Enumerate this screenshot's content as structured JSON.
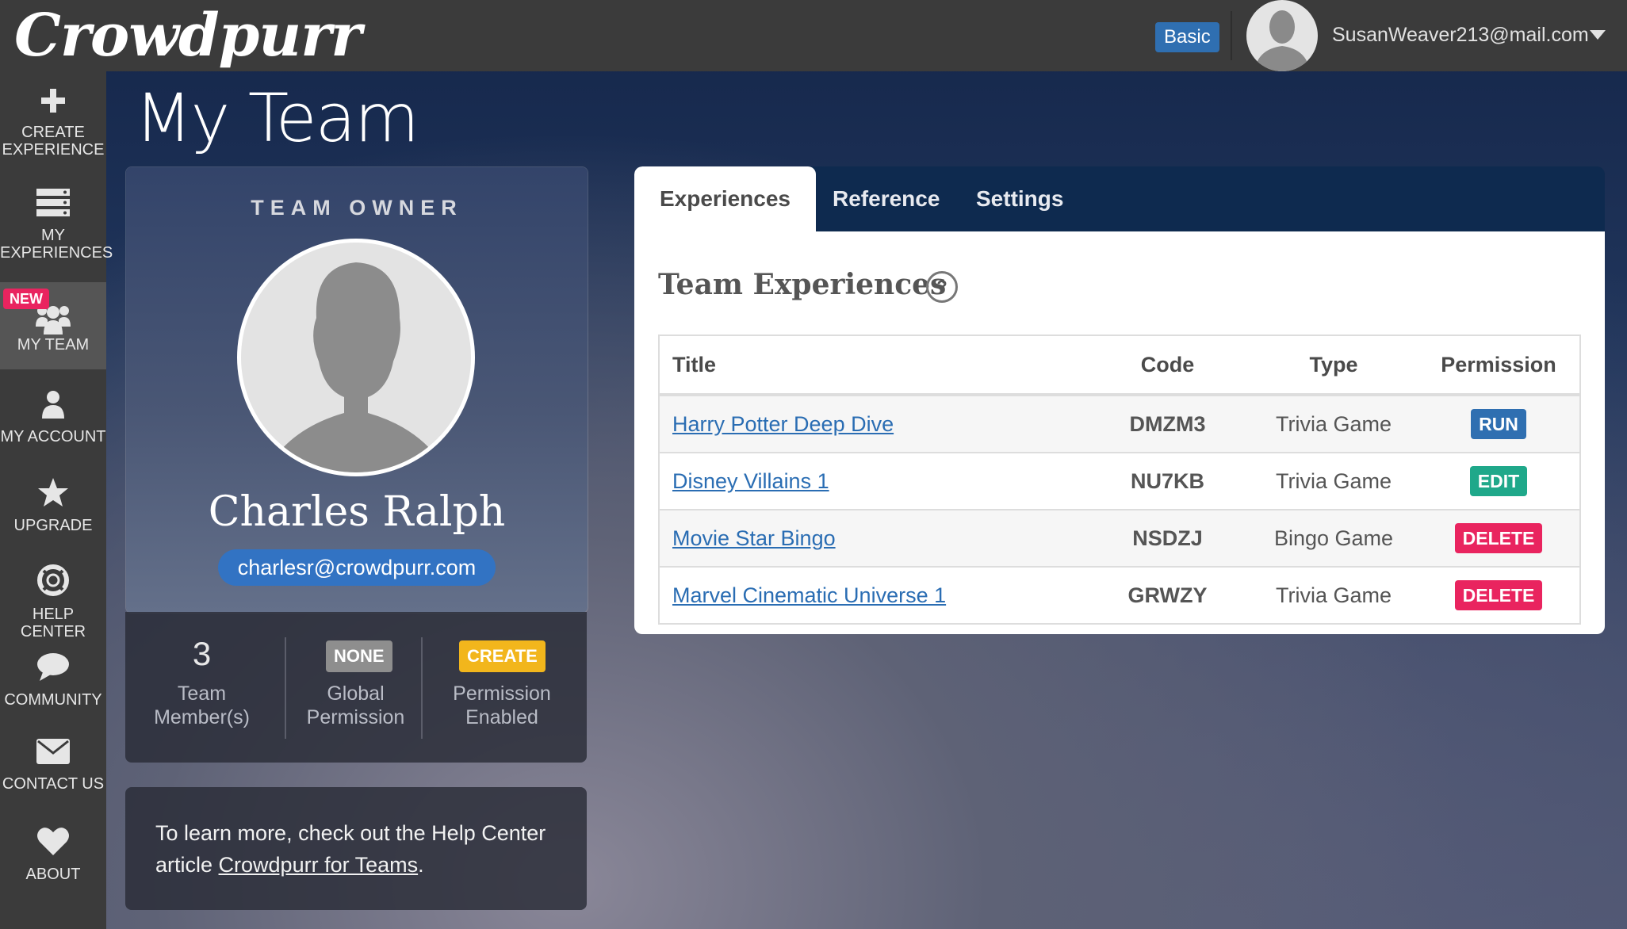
{
  "app": {
    "logo_text": "Crowdpurr",
    "plan_badge": "Basic",
    "user_email": "SusanWeaver213@mail.com"
  },
  "sidebar": {
    "items": [
      {
        "label_line1": "CREATE",
        "label_line2": "EXPERIENCE",
        "icon": "plus-icon"
      },
      {
        "label_line1": "MY",
        "label_line2": "EXPERIENCES",
        "icon": "list-icon"
      },
      {
        "label_line1": "MY TEAM",
        "label_line2": "",
        "icon": "team-icon",
        "badge": "NEW",
        "active": true
      },
      {
        "label_line1": "MY ACCOUNT",
        "label_line2": "",
        "icon": "user-icon"
      },
      {
        "label_line1": "UPGRADE",
        "label_line2": "",
        "icon": "star-icon"
      },
      {
        "label_line1": "HELP CENTER",
        "label_line2": "",
        "icon": "lifebuoy-icon"
      },
      {
        "label_line1": "COMMUNITY",
        "label_line2": "",
        "icon": "chat-icon"
      },
      {
        "label_line1": "CONTACT US",
        "label_line2": "",
        "icon": "envelope-icon"
      },
      {
        "label_line1": "ABOUT",
        "label_line2": "",
        "icon": "heart-icon"
      }
    ]
  },
  "page": {
    "title": "My Team"
  },
  "owner_card": {
    "heading": "TEAM OWNER",
    "name": "Charles Ralph",
    "email": "charlesr@crowdpurr.com",
    "stats": {
      "members_count": "3",
      "members_label_1": "Team",
      "members_label_2": "Member(s)",
      "global_badge": "NONE",
      "global_label_1": "Global",
      "global_label_2": "Permission",
      "create_badge": "CREATE",
      "create_label_1": "Permission",
      "create_label_2": "Enabled"
    }
  },
  "help_box": {
    "text_before": "To learn more, check out the Help Center article ",
    "link_text": "Crowdpurr for Teams",
    "text_after": "."
  },
  "tabs": [
    {
      "label": "Experiences",
      "active": true
    },
    {
      "label": "Reference",
      "active": false
    },
    {
      "label": "Settings",
      "active": false
    }
  ],
  "experiences": {
    "section_title": "Team Experiences",
    "help_glyph": "?",
    "columns": [
      "Title",
      "Code",
      "Type",
      "Permission"
    ],
    "rows": [
      {
        "title": "Harry Potter Deep Dive",
        "code": "DMZM3",
        "type": "Trivia Game",
        "permission": "RUN"
      },
      {
        "title": "Disney Villains 1",
        "code": "NU7KB",
        "type": "Trivia Game",
        "permission": "EDIT"
      },
      {
        "title": "Movie Star Bingo",
        "code": "NSDZJ",
        "type": "Bingo Game",
        "permission": "DELETE"
      },
      {
        "title": "Marvel Cinematic Universe 1",
        "code": "GRWZY",
        "type": "Trivia Game",
        "permission": "DELETE"
      }
    ]
  },
  "colors": {
    "run": "#2f6fb1",
    "edit": "#1fa88a",
    "delete": "#e9245f",
    "none": "#8e8e8e",
    "create": "#f2b61c",
    "tabbar": "#0e2a4f",
    "accent": "#3273c3"
  }
}
